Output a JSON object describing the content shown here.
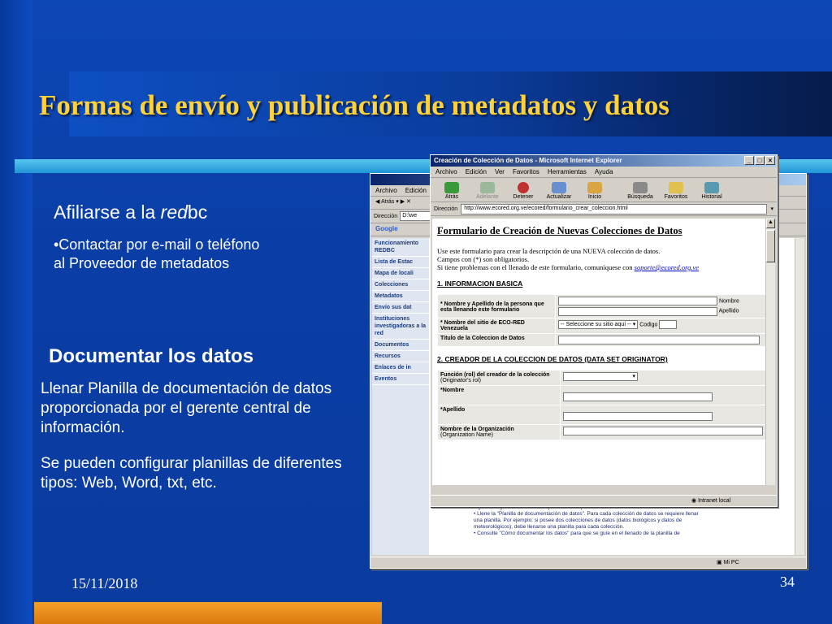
{
  "slide": {
    "title": "Formas de envío y publicación de metadatos y datos",
    "section1": {
      "heading_prefix": "Afiliarse a la ",
      "heading_em": "red",
      "heading_suffix": "bc",
      "bullet_line1": "•Contactar por e-mail o teléfono",
      "bullet_line2": "al Proveedor de metadatos"
    },
    "section2": {
      "heading": "Documentar los datos",
      "para1": " Llenar Planilla de documentación de datos proporcionada por el gerente central de información.",
      "para2": "Se pueden configurar planillas de diferentes tipos: Web, Word, txt, etc."
    },
    "footer": {
      "date": "15/11/2018",
      "page": "34"
    }
  },
  "front_window": {
    "title": "Creación de Colección de Datos - Microsoft Internet Explorer",
    "menu": [
      "Archivo",
      "Edición",
      "Ver",
      "Favoritos",
      "Herramientas",
      "Ayuda"
    ],
    "toolbar": [
      "Atrás",
      "Adelante",
      "Detener",
      "Actualizar",
      "Inicio",
      "Búsqueda",
      "Favoritos",
      "Historial"
    ],
    "address_label": "Dirección",
    "address": "http://www.ecored.org.ve/ecored/formulario_crear_coleccion.html",
    "form_title": "Formulario de Creación de Nuevas Colecciones de Datos",
    "intro1": "Use este formulario para crear la descripción de una NUEVA colección de datos.",
    "intro2": "Campos con (*) son obligatorios.",
    "intro3": "Si tiene problemas con el llenado de este formulario, comuníquese con ",
    "intro_link": "soporte@ecored.org.ve",
    "section1": "1. INFORMACION BASICA",
    "f_nombre_apellido": "* Nombre y Apellido de la persona que esta llenando este formulario",
    "lbl_nombre": "Nombre",
    "lbl_apellido": "Apellido",
    "f_sitio": "* Nombre del sitio de ECO-RED Venezuela",
    "sitio_select": "-- Seleccione su sitio aquí --",
    "lbl_codigo": "Codigo",
    "f_titulo": "Titulo de la Coleccion de Datos",
    "section2": "2. CREADOR DE LA COLECCION DE DATOS (DATA SET ORIGINATOR)",
    "f_funcion": "Función (rol) del creador de la colección",
    "f_funcion_sub": "(Originator's rol)",
    "f_nombre": "*Nombre",
    "f_apellido": "*Apellido",
    "f_org": "Nombre de la Organización",
    "f_org_sub": "(Organization Name)",
    "status": "Intranet local"
  },
  "back_window": {
    "menu": [
      "Archivo",
      "Edición"
    ],
    "back_btn": "Atrás",
    "address_label": "Dirección",
    "address": "D:\\we",
    "google": "Google",
    "sidebar": [
      "Funcionamiento REDBC",
      "Lista de Estac",
      "Mapa de locali",
      "Colecciones",
      "Metadatos",
      "Envío sus dat",
      "Instituciones investigadoras a la red",
      "Documentos",
      "Recursos",
      "Enlaces de in",
      "Eventos"
    ],
    "body_text": [
      "algunos sugerencias de interés para un manejo más adecuado de la información.",
      "• Llene la \"Planilla de documentación de datos\". Para cada colección de datos se requiere llenar",
      "una planilla. Por ejemplo: si posee dos colecciones de datos (datos biológicos y datos de",
      "meteorológicos), debe llenarse una planilla para cada colección.",
      "• Consulte \"Cómo documentar los datos\" para que se guíe en el llenado de la planilla de"
    ],
    "status": "Mi PC"
  },
  "colors": {
    "title": "#ffd23a",
    "background": "#0d47b5",
    "accent_bar": "#3fb3e8",
    "orange_bar": "#e88a1a"
  }
}
